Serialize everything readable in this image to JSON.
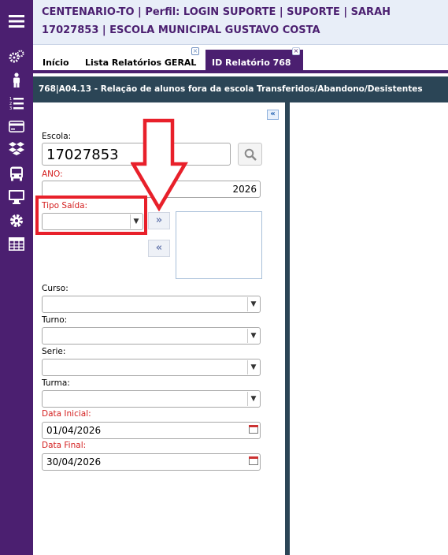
{
  "header": {
    "line1": "CENTENARIO-TO | Perfil: LOGIN SUPORTE | SUPORTE | SARAH",
    "line2": "17027853 | ESCOLA MUNICIPAL GUSTAVO COSTA"
  },
  "sidebar": {
    "icons": [
      "menu-icon",
      "person-icon",
      "list-icon",
      "card-icon",
      "boxes-icon",
      "bus-icon",
      "monitor-icon",
      "gear-icon",
      "table-icon"
    ]
  },
  "tabs": [
    {
      "label": "Início"
    },
    {
      "label": "Lista Relatórios GERAL"
    },
    {
      "label": "ID Relatório 768"
    }
  ],
  "report_title": "768|A04.13 - Relação de alunos fora da escola Transferidos/Abandono/Desistentes",
  "form": {
    "escola_label": "Escola:",
    "escola_value": "17027853",
    "ano_label": "ANO:",
    "ano_value": "2026",
    "tipo_saida_label": "Tipo Saída:",
    "tipo_saida_value": "",
    "curso_label": "Curso:",
    "curso_value": "",
    "turno_label": "Turno:",
    "turno_value": "",
    "serie_label": "Serie:",
    "serie_value": "",
    "turma_label": "Turma:",
    "turma_value": "",
    "data_inicial_label": "Data Inicial:",
    "data_inicial_value": "01/04/2026",
    "data_final_label": "Data Final:",
    "data_final_value": "30/04/2026",
    "add_button": "»",
    "remove_button": "«",
    "collapse_button": "«"
  },
  "colors": {
    "sidebar": "#4b1f70",
    "titlebar": "#2b4556",
    "header_bg": "#e8eef8",
    "required": "#d42020",
    "annotation": "#e8202a"
  }
}
